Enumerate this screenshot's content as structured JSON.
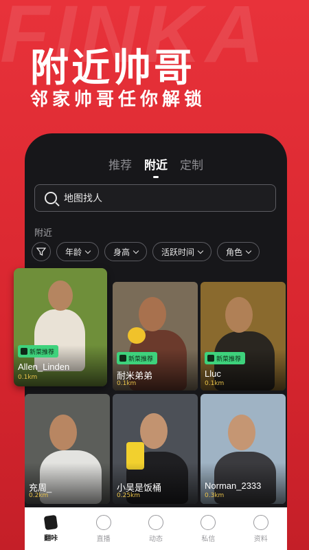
{
  "watermark": "FINKA",
  "hero": {
    "title": "附近帅哥",
    "subtitle": "邻家帅哥任你解锁"
  },
  "tabs": [
    {
      "label": "推荐",
      "active": false
    },
    {
      "label": "附近",
      "active": true
    },
    {
      "label": "定制",
      "active": false
    }
  ],
  "search": {
    "text": "地图找人"
  },
  "section": {
    "label": "附近"
  },
  "filters": [
    {
      "label": "年龄"
    },
    {
      "label": "身高"
    },
    {
      "label": "活跃时间"
    },
    {
      "label": "角色"
    }
  ],
  "badge_text": "新菜推荐",
  "cards": [
    {
      "name": "Allen_Linden",
      "distance": "0.1km",
      "badge": true,
      "bg": "#6f8f3a"
    },
    {
      "name": "耐米弟弟",
      "distance": "0.1km",
      "badge": true,
      "bg": "#7a6c58"
    },
    {
      "name": "Lluc",
      "distance": "0.1km",
      "badge": true,
      "bg": "#8a6a2e"
    },
    {
      "name": "充周_",
      "distance": "0.2km",
      "badge": false,
      "bg": "#5c5e5a"
    },
    {
      "name": "小昊是饭桶",
      "distance": "0.25km",
      "badge": false,
      "bg": "#4c5057"
    },
    {
      "name": "Norman_2333",
      "distance": "0.3km",
      "badge": false,
      "bg": "#9fb3c4"
    }
  ],
  "bottom_nav": [
    {
      "label": "翻咔",
      "icon": "cards-icon",
      "active": true
    },
    {
      "label": "直播",
      "icon": "play-icon",
      "active": false
    },
    {
      "label": "动态",
      "icon": "compass-icon",
      "active": false
    },
    {
      "label": "私信",
      "icon": "chat-icon",
      "active": false
    },
    {
      "label": "资料",
      "icon": "profile-icon",
      "active": false
    }
  ]
}
